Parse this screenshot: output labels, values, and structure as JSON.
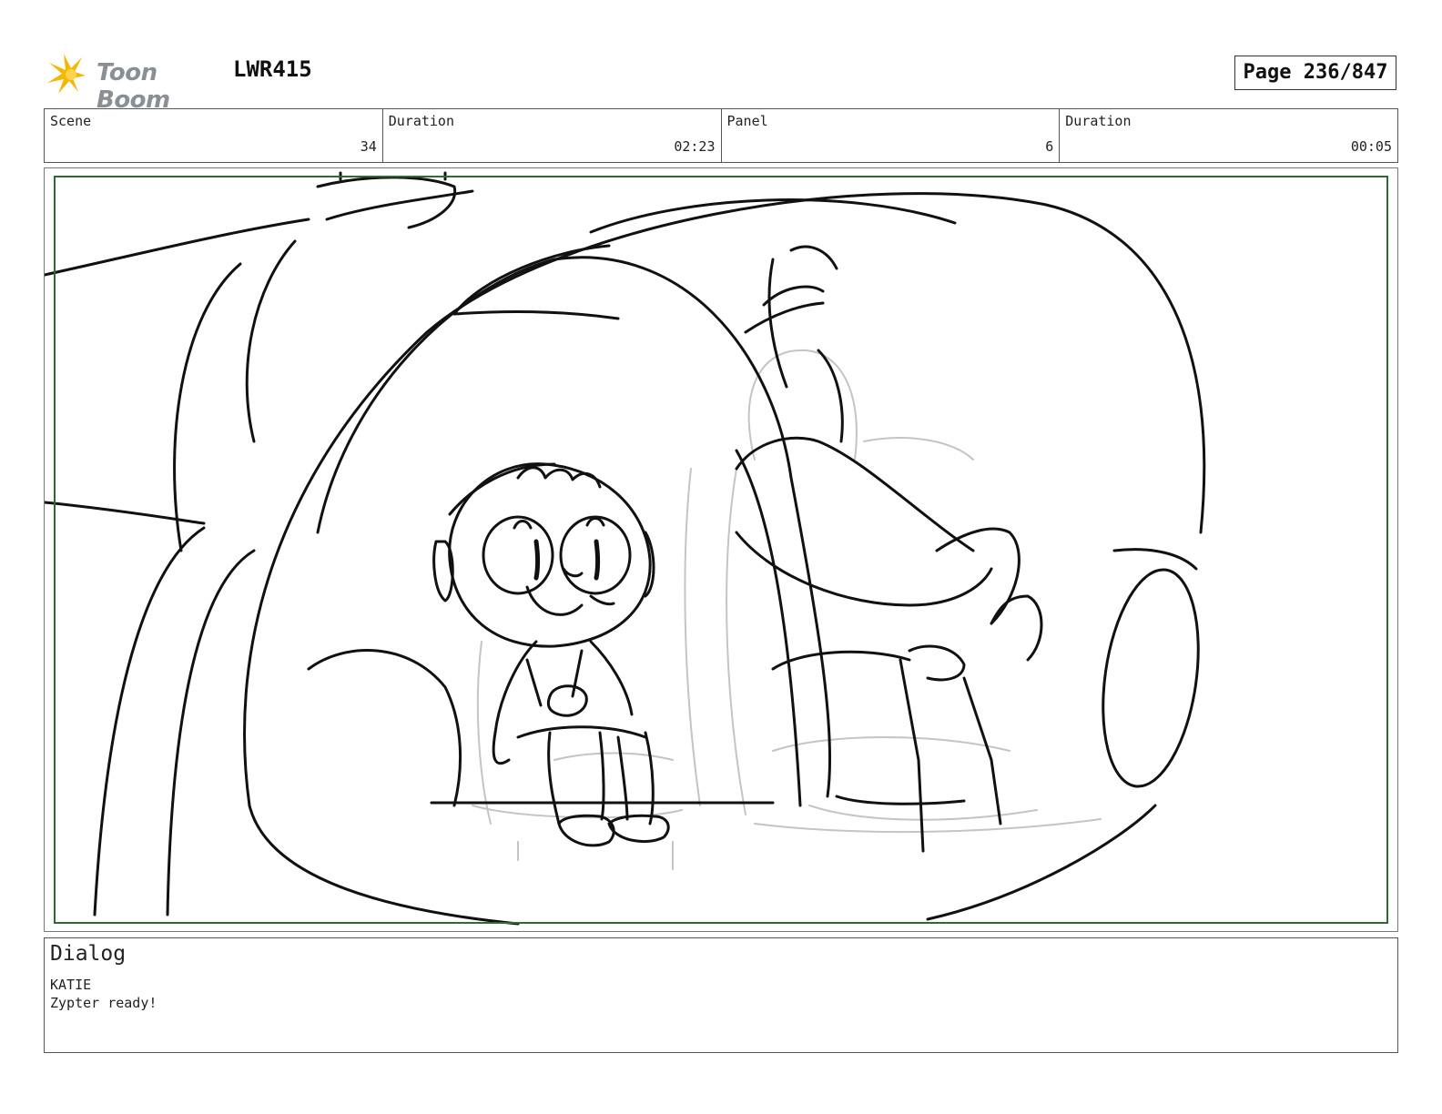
{
  "header": {
    "logo_text": "Toon Boom",
    "production_code": "LWR415",
    "page_label": "Page 236/847"
  },
  "info": {
    "scene_label": "Scene",
    "scene_value": "34",
    "scene_duration_label": "Duration",
    "scene_duration_value": "02:23",
    "panel_label": "Panel",
    "panel_value": "6",
    "panel_duration_label": "Duration",
    "panel_duration_value": "00:05"
  },
  "dialog": {
    "title": "Dialog",
    "speaker": "KATIE",
    "line": "Zypter ready!"
  },
  "colors": {
    "safe_area": "#2e6b2e",
    "logo_star": "#f5b800",
    "logo_text": "#8a8f96"
  }
}
